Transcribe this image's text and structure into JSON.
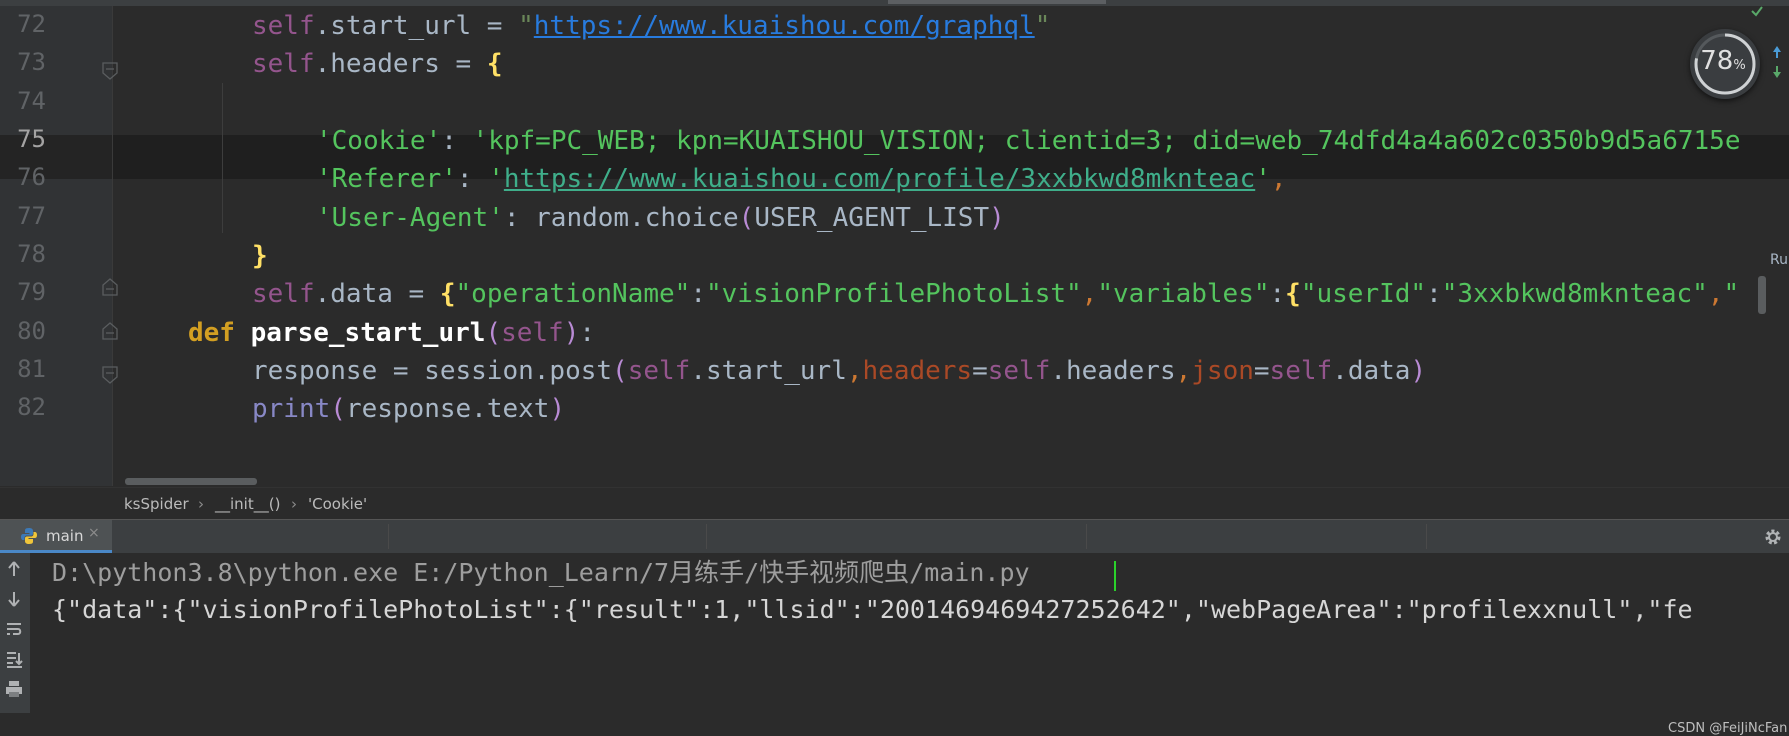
{
  "editor": {
    "line_numbers": [
      "72",
      "73",
      "74",
      "75",
      "76",
      "77",
      "78",
      "79",
      "80",
      "81",
      "82"
    ],
    "current_line": "75",
    "lines": {
      "l72": {
        "indent": "    ",
        "self": "self",
        "attr": ".start_url = ",
        "q1": "\"",
        "url": "https://www.kuaishou.com/graphql",
        "q2": "\""
      },
      "l73": {
        "self": "self",
        "attr": ".headers = ",
        "brace": "{"
      },
      "l75": {
        "key": "'Cookie'",
        "colon": ": ",
        "value": "'kpf=PC_WEB; kpn=KUAISHOU_VISION; clientid=3; did=web_74dfd4a4a602c0350b9d5a6715e"
      },
      "l76": {
        "key": "'Referer'",
        "colon": ": ",
        "q1": "'",
        "url": "https://www.kuaishou.com/profile/3xxbkwd8mknteac",
        "q2": "'",
        "comma": ","
      },
      "l77": {
        "key": "'User-Agent'",
        "colon": ": random.choice",
        "p1": "(",
        "arg": "USER_AGENT_LIST",
        "p2": ")"
      },
      "l78": {
        "brace": "}"
      },
      "l79": {
        "self": "self",
        "attr": ".data = ",
        "brace": "{",
        "k1": "\"operationName\"",
        "c1": ":",
        "v1": "\"visionProfilePhotoList\"",
        "c2": ",",
        "k2": "\"variables\"",
        "c3": ":",
        "b2": "{",
        "k3": "\"userId\"",
        "c4": ":",
        "v3": "\"3xxbkwd8mknteac\"",
        "c5": ",",
        "tail": "\""
      },
      "l80": {
        "def": "def",
        "name": "parse_start_url",
        "p1": "(",
        "self": "self",
        "p2": ")",
        "colon": ":"
      },
      "l81": {
        "a": "response = session.post",
        "p1": "(",
        "self1": "self",
        "b": ".start_url",
        "c1": ",",
        "kw1": "headers",
        "eq1": "=",
        "self2": "self",
        "d": ".headers",
        "c2": ",",
        "kw2": "json",
        "eq2": "=",
        "self3": "self",
        "e": ".data",
        "p2": ")"
      },
      "l82": {
        "fn": "print",
        "p1": "(",
        "arg": "response.text",
        "p2": ")"
      }
    }
  },
  "widget": {
    "memory_value": "78",
    "memory_unit": "%",
    "memory_percent": 78
  },
  "side_label": "Ru",
  "breadcrumb": {
    "items": [
      "ksSpider",
      "__init__()",
      "'Cookie'"
    ],
    "separator": "›"
  },
  "run_panel": {
    "tab_label": "main",
    "tab_close": "×",
    "console_lines": [
      "D:\\python3.8\\python.exe E:/Python_Learn/7月练手/快手视频爬虫/main.py",
      "{\"data\":{\"visionProfilePhotoList\":{\"result\":1,\"llsid\":\"2001469469427252642\",\"webPageArea\":\"profilexxnull\",\"fe"
    ]
  },
  "watermark": "CSDN @FeiJiNcFan",
  "icons": {
    "fold": "fold-marker-icon",
    "python": "python-icon",
    "settings": "gear-icon",
    "up": "arrow-up-icon",
    "down": "arrow-down-icon",
    "wrap": "soft-wrap-icon",
    "scroll_end": "scroll-to-end-icon",
    "print": "print-icon",
    "check": "check-icon"
  },
  "colors": {
    "self": "#94558d",
    "string": "#6a8759",
    "keyword": "#cc7832",
    "link": "#287bde",
    "background": "#2b2b2b",
    "accent": "#4a88c7"
  }
}
